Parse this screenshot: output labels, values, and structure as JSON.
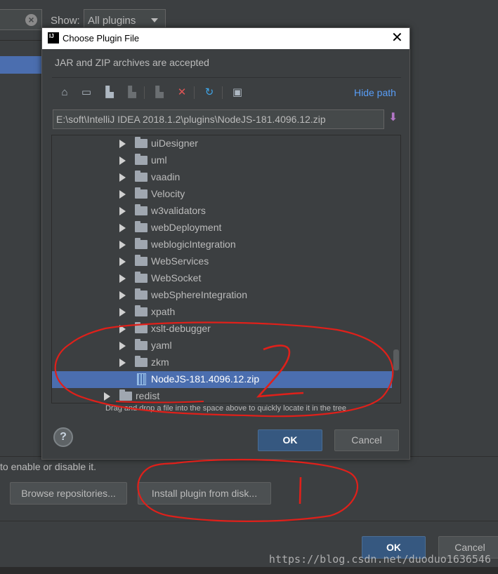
{
  "background": {
    "show_label": "Show:",
    "filter_value": "All plugins",
    "hint": "to enable or disable it.",
    "browse_button": "Browse repositories...",
    "install_button": "Install plugin from disk...",
    "ok_button": "OK",
    "cancel_button": "Cancel"
  },
  "dialog": {
    "title": "Choose Plugin File",
    "logo_text": "IJ",
    "accepted_text": "JAR and ZIP archives are accepted",
    "hide_path_link": "Hide path",
    "path_value": "E:\\soft\\IntelliJ IDEA 2018.1.2\\plugins\\NodeJS-181.4096.12.zip",
    "tree": [
      {
        "label": "uiDesigner",
        "type": "folder"
      },
      {
        "label": "uml",
        "type": "folder"
      },
      {
        "label": "vaadin",
        "type": "folder"
      },
      {
        "label": "Velocity",
        "type": "folder"
      },
      {
        "label": "w3validators",
        "type": "folder"
      },
      {
        "label": "webDeployment",
        "type": "folder"
      },
      {
        "label": "weblogicIntegration",
        "type": "folder"
      },
      {
        "label": "WebServices",
        "type": "folder"
      },
      {
        "label": "WebSocket",
        "type": "folder"
      },
      {
        "label": "webSphereIntegration",
        "type": "folder"
      },
      {
        "label": "xpath",
        "type": "folder"
      },
      {
        "label": "xslt-debugger",
        "type": "folder"
      },
      {
        "label": "yaml",
        "type": "folder"
      },
      {
        "label": "zkm",
        "type": "folder"
      },
      {
        "label": "NodeJS-181.4096.12.zip",
        "type": "zip",
        "selected": true
      },
      {
        "label": "redist",
        "type": "folder"
      }
    ],
    "dnd_hint": "Drag and drop a file into the space above to quickly locate it in the tree",
    "help_label": "?",
    "ok_button": "OK",
    "cancel_button": "Cancel"
  },
  "toolbar_icons": [
    "home-icon",
    "desktop-icon",
    "new-folder-icon",
    "project-folder-icon",
    "module-folder-icon",
    "delete-icon",
    "refresh-icon",
    "show-hidden-icon"
  ],
  "annotations": {
    "mark_1": "1",
    "mark_2": "2"
  },
  "watermark": "https://blog.csdn.net/duoduo1636546",
  "colors": {
    "accent": "#4b6eaf",
    "ok_button": "#365880",
    "link": "#589df6",
    "ink": "#e0201a"
  }
}
